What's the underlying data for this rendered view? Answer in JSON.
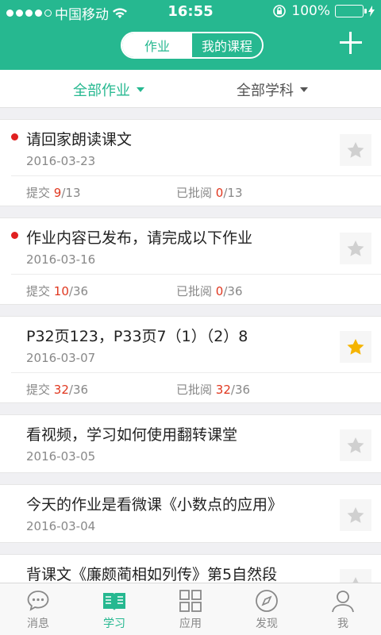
{
  "status": {
    "carrier": "中国移动",
    "time": "16:55",
    "battery": "100%"
  },
  "header": {
    "seg_homework": "作业",
    "seg_courses": "我的课程",
    "add_icon": "plus-icon"
  },
  "filters": {
    "all_homework": "全部作业",
    "all_subjects": "全部学科"
  },
  "labels": {
    "submitted": "提交",
    "reviewed": "已批阅"
  },
  "colors": {
    "accent": "#26b890",
    "highlight": "#e0371f",
    "star_active": "#f5b400",
    "star_inactive": "#d0d0d0"
  },
  "assignments": [
    {
      "title": "请回家朗读课文",
      "date": "2016-03-23",
      "unread": true,
      "starred": false,
      "submitted": "9",
      "submitted_total": "/13",
      "reviewed": "0",
      "reviewed_total": "/13"
    },
    {
      "title": "作业内容已发布，请完成以下作业",
      "date": "2016-03-16",
      "unread": true,
      "starred": false,
      "submitted": "10",
      "submitted_total": "/36",
      "reviewed": "0",
      "reviewed_total": "/36"
    },
    {
      "title": "P32页123，P33页7（1）（2）8",
      "date": "2016-03-07",
      "unread": false,
      "starred": true,
      "submitted": "32",
      "submitted_total": "/36",
      "reviewed": "32",
      "reviewed_total": "/36"
    },
    {
      "title": "看视频，学习如何使用翻转课堂",
      "date": "2016-03-05",
      "unread": false,
      "starred": false
    },
    {
      "title": "今天的作业是看微课《小数点的应用》",
      "date": "2016-03-04",
      "unread": false,
      "starred": false
    },
    {
      "title": "背课文《廉颇蔺相如列传》第5自然段",
      "date": "",
      "unread": false,
      "starred": false
    }
  ],
  "tabs": [
    {
      "label": "消息",
      "icon": "message-icon"
    },
    {
      "label": "学习",
      "icon": "book-icon"
    },
    {
      "label": "应用",
      "icon": "grid-icon"
    },
    {
      "label": "发现",
      "icon": "compass-icon"
    },
    {
      "label": "我",
      "icon": "person-icon"
    }
  ]
}
